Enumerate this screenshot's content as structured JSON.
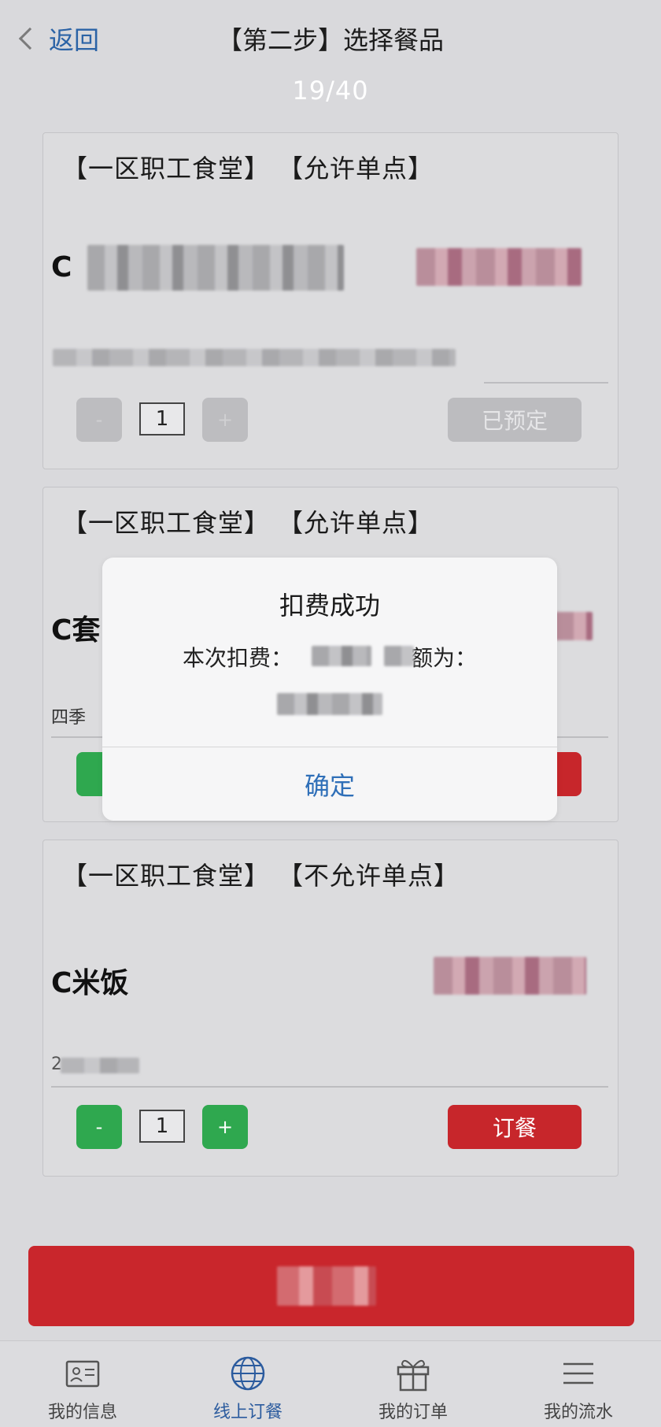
{
  "header": {
    "back_label": "返回",
    "title": "【第二步】选择餐品",
    "page_counter": "19/40"
  },
  "cards": [
    {
      "canteen": "【一区职工食堂】",
      "policy": "【允许单点】",
      "dish_name": "C",
      "quantity": "1",
      "minus": "-",
      "plus": "+",
      "action_label": "已预定"
    },
    {
      "canteen": "【一区职工食堂】",
      "policy": "【允许单点】",
      "dish_name": "C套",
      "note": "四季"
    },
    {
      "canteen": "【一区职工食堂】",
      "policy": "【不允许单点】",
      "dish_name": "C米饭",
      "note": "2",
      "quantity": "1",
      "minus": "-",
      "plus": "+",
      "action_label": "订餐"
    }
  ],
  "modal": {
    "title": "扣费成功",
    "message_prefix": "本次扣费：",
    "message_suffix": "额为：",
    "confirm_label": "确定"
  },
  "tabbar": {
    "items": [
      {
        "label": "我的信息",
        "icon": "id-card-icon",
        "active": false
      },
      {
        "label": "线上订餐",
        "icon": "globe-icon",
        "active": true
      },
      {
        "label": "我的订单",
        "icon": "gift-icon",
        "active": false
      },
      {
        "label": "我的流水",
        "icon": "menu-icon",
        "active": false
      }
    ]
  },
  "colors": {
    "accent_blue": "#2f6fb8",
    "order_red": "#c7262b",
    "stepper_green": "#2fa84f",
    "overlay_grey": "#d9d9dc"
  }
}
